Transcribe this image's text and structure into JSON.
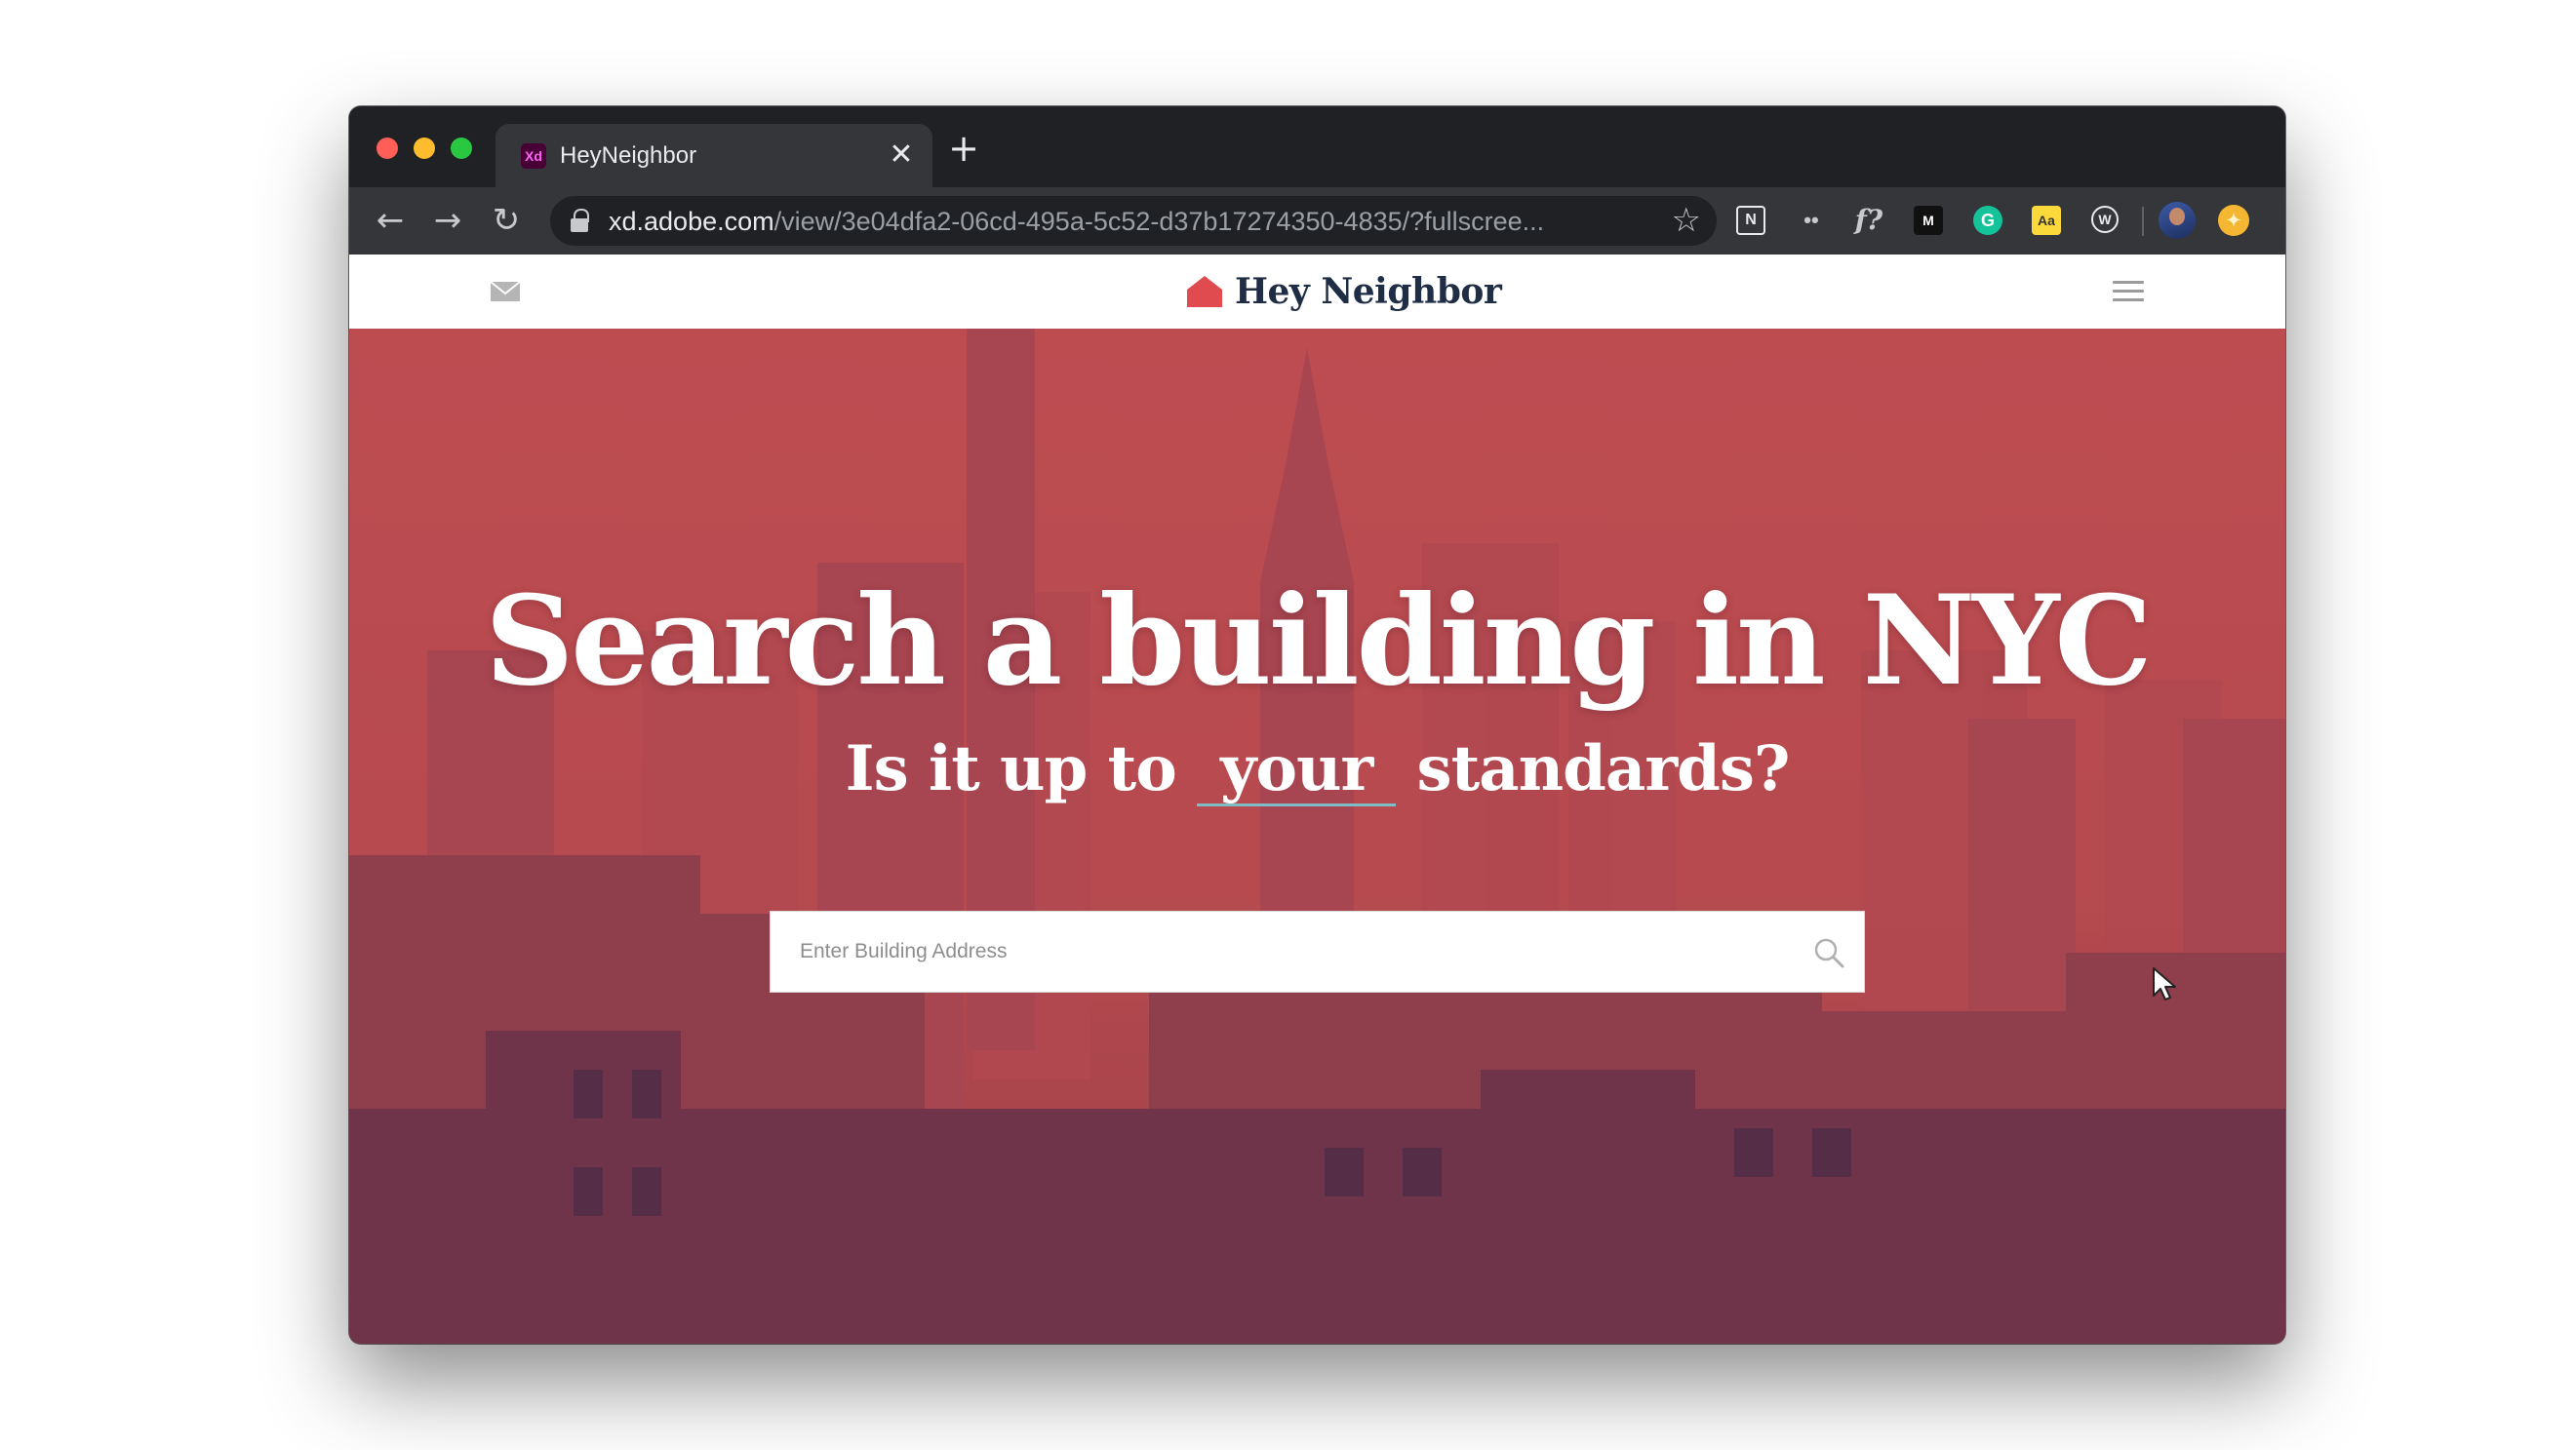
{
  "browser": {
    "tab": {
      "favicon_text": "Xd",
      "title": "HeyNeighbor",
      "close_glyph": "✕"
    },
    "new_tab_glyph": "+",
    "nav": {
      "back": "←",
      "forward": "→",
      "reload": "↻"
    },
    "address": {
      "host": "xd.adobe.com",
      "path": "/view/3e04dfa2-06cd-495a-5c52-d37b17274350-4835/?fullscree..."
    },
    "bookmark_glyph": "☆",
    "extensions": {
      "notion": "N",
      "dots": "••",
      "func": "f?",
      "medium": "M",
      "grammarly": "G",
      "dictionary": "Aa",
      "wordtune": "W",
      "coin": "✦"
    },
    "colors": {
      "chrome_dark": "#202124",
      "chrome_toolbar": "#35363a"
    }
  },
  "site": {
    "logo_text": "Hey Neighbor",
    "colors": {
      "brand_red": "#e04b4f",
      "brand_navy": "#1f2d45",
      "hero_tint": "#b94b4f",
      "underline": "#7ebcc6"
    },
    "icons": {
      "left": "mail-icon",
      "right": "hamburger-menu-icon"
    }
  },
  "hero": {
    "title": "Search a building in NYC",
    "subtitle_before": "Is it up to",
    "subtitle_blank": "your",
    "subtitle_after": "standards?",
    "search": {
      "placeholder": "Enter Building Address",
      "value": ""
    }
  }
}
